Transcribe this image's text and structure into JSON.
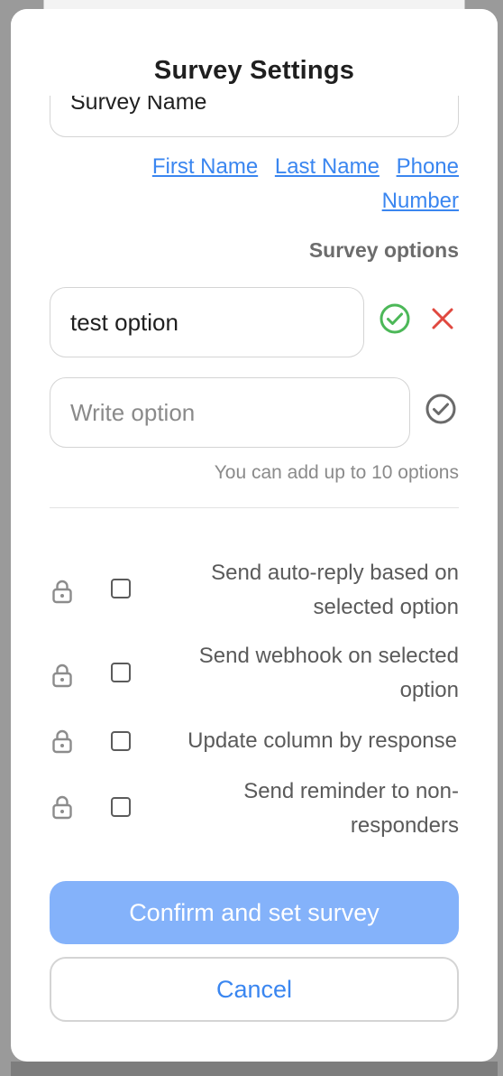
{
  "modal": {
    "title": "Survey Settings",
    "survey_name_value": "Survey Name"
  },
  "variables": [
    "First Name",
    "Last Name",
    "Phone Number"
  ],
  "options_section": {
    "label": "Survey options",
    "existing_option": "test option",
    "new_option_placeholder": "Write option",
    "hint": "You can add up to 10 options"
  },
  "settings": [
    {
      "label_line1": "Send auto-reply based on",
      "label_line2": "selected option",
      "checked": false,
      "locked": true
    },
    {
      "label_line1": "Send webhook on selected",
      "label_line2": "option",
      "checked": false,
      "locked": true
    },
    {
      "label_line1": "Update column by response",
      "label_line2": "",
      "checked": false,
      "locked": true
    },
    {
      "label_line1": "Send reminder to non-",
      "label_line2": "responders",
      "checked": false,
      "locked": true
    }
  ],
  "buttons": {
    "confirm": "Confirm and set survey",
    "cancel": "Cancel"
  },
  "icons": {
    "confirm_option": "check-circle-icon",
    "delete_option": "close-icon",
    "add_option": "check-circle-icon",
    "lock": "lock-icon"
  },
  "colors": {
    "accent": "#3a86f0",
    "confirm_disabled": "#84b2fa",
    "success": "#4cb858",
    "danger": "#e0483f"
  }
}
